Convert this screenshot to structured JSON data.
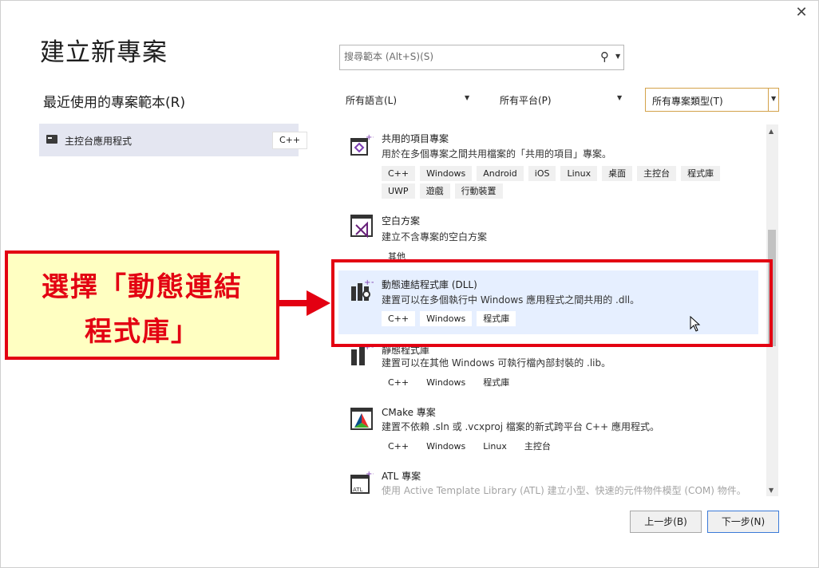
{
  "window": {
    "title": "建立新專案",
    "close_glyph": "✕"
  },
  "recent": {
    "heading": "最近使用的專案範本(R)",
    "items": [
      {
        "label": "主控台應用程式",
        "tag": "C++"
      }
    ]
  },
  "search": {
    "placeholder": "搜尋範本 (Alt+S)(S)"
  },
  "filters": {
    "language": "所有語言(L)",
    "platform": "所有平台(P)",
    "type": "所有專案類型(T)"
  },
  "templates": [
    {
      "name": "共用的項目專案",
      "desc": "用於在多個專案之間共用檔案的「共用的項目」專案。",
      "tags": [
        "C++",
        "Windows",
        "Android",
        "iOS",
        "Linux",
        "桌面",
        "主控台",
        "程式庫",
        "UWP",
        "遊戲",
        "行動裝置"
      ]
    },
    {
      "name": "空白方案",
      "desc": "建立不含專案的空白方案",
      "tags": [
        "其他"
      ]
    },
    {
      "name": "動態連結程式庫 (DLL)",
      "desc": "建置可以在多個執行中 Windows 應用程式之間共用的 .dll。",
      "tags": [
        "C++",
        "Windows",
        "程式庫"
      ]
    },
    {
      "name": "靜態程式庫",
      "desc": "建置可以在其他 Windows 可執行檔內部封裝的 .lib。",
      "tags": [
        "C++",
        "Windows",
        "程式庫"
      ]
    },
    {
      "name": "CMake 專案",
      "desc": "建置不依賴 .sln 或 .vcxproj 檔案的新式跨平台 C++ 應用程式。",
      "tags": [
        "C++",
        "Windows",
        "Linux",
        "主控台"
      ]
    },
    {
      "name": "ATL 專案",
      "desc": "使用 Active Template Library (ATL) 建立小型、快速的元件物件模型 (COM) 物件。",
      "tags": []
    }
  ],
  "annotation": {
    "line1": "選擇「動態連結",
    "line2": "程式庫」"
  },
  "buttons": {
    "back": "上一步(B)",
    "next": "下一步(N)"
  },
  "colors": {
    "accent_red": "#e30012",
    "callout_bg": "#ffffc2",
    "selection": "#e6efff"
  },
  "icons": [
    "shared-items-icon",
    "blank-solution-icon",
    "dll-library-icon",
    "static-library-icon",
    "cmake-icon",
    "atl-project-icon",
    "console-app-icon",
    "search-icon"
  ]
}
